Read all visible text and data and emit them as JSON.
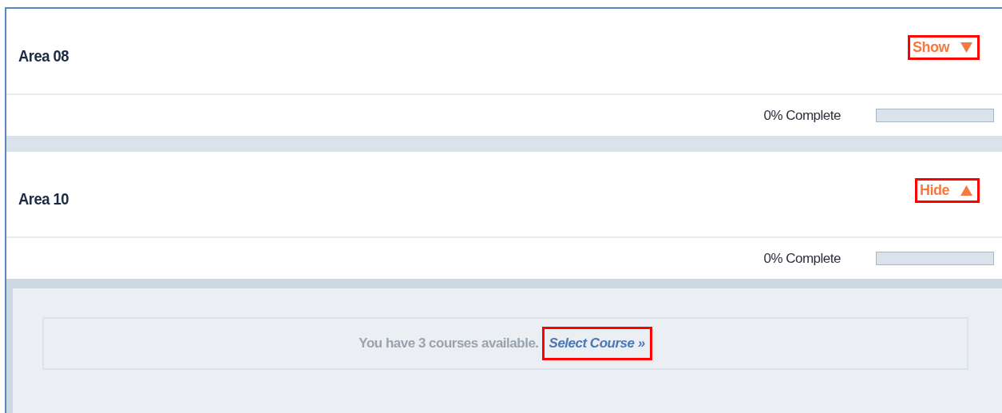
{
  "sections": [
    {
      "title": "Area 08",
      "toggle": {
        "label": "Show",
        "expanded": false,
        "highlighted": true
      },
      "progress": {
        "label": "0% Complete",
        "level": 0
      }
    },
    {
      "title": "Area 10",
      "toggle": {
        "label": "Hide",
        "expanded": true,
        "highlighted": true
      },
      "progress": {
        "label": "0% Complete",
        "level": 0
      },
      "body": {
        "message": "You have 3 courses available.",
        "link": {
          "label": "Select Course »",
          "highlighted": true
        }
      }
    }
  ]
}
